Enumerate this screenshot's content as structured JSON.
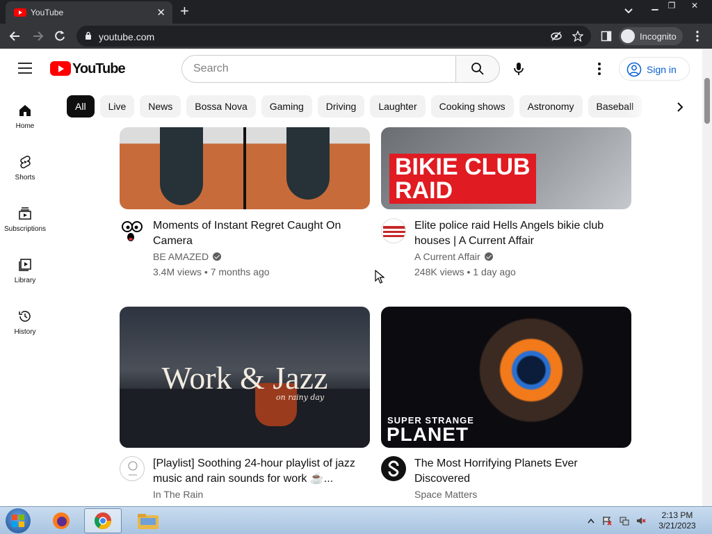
{
  "browser": {
    "tab_title": "YouTube",
    "url": "youtube.com",
    "incognito_label": "Incognito"
  },
  "header": {
    "logo_text": "YouTube",
    "search_placeholder": "Search",
    "sign_in_label": "Sign in"
  },
  "chips": [
    "All",
    "Live",
    "News",
    "Bossa Nova",
    "Gaming",
    "Driving",
    "Laughter",
    "Cooking shows",
    "Astronomy",
    "Baseball"
  ],
  "sidebar": {
    "items": [
      {
        "label": "Home",
        "icon": "home-icon"
      },
      {
        "label": "Shorts",
        "icon": "shorts-icon"
      },
      {
        "label": "Subscriptions",
        "icon": "subscriptions-icon"
      },
      {
        "label": "Library",
        "icon": "library-icon"
      },
      {
        "label": "History",
        "icon": "history-icon"
      }
    ]
  },
  "videos": [
    {
      "title": "Moments of Instant Regret Caught On Camera",
      "channel": "BE AMAZED",
      "verified": true,
      "stats": "3.4M views • 7 months ago"
    },
    {
      "title": "Elite police raid Hells Angels bikie club houses | A Current Affair",
      "channel": "A Current Affair",
      "verified": true,
      "stats": "248K views • 1 day ago",
      "thumb_text_1": "BIKIE CLUB",
      "thumb_text_2": "RAID"
    },
    {
      "title": "[Playlist] Soothing 24-hour playlist of jazz music and rain sounds for work ☕...",
      "channel": "In The Rain",
      "verified": false,
      "thumb_text_1": "Work & Jazz",
      "thumb_text_2": "on rainy day"
    },
    {
      "title": "The Most Horrifying Planets Ever Discovered",
      "channel": "Space Matters",
      "verified": false,
      "thumb_text_1": "SUPER STRANGE",
      "thumb_text_2": "PLANET"
    }
  ],
  "taskbar": {
    "time": "2:13 PM",
    "date": "3/21/2023"
  },
  "colors": {
    "youtube_red": "#ff0000",
    "chrome_dark": "#202124",
    "link_blue": "#065fd4"
  }
}
